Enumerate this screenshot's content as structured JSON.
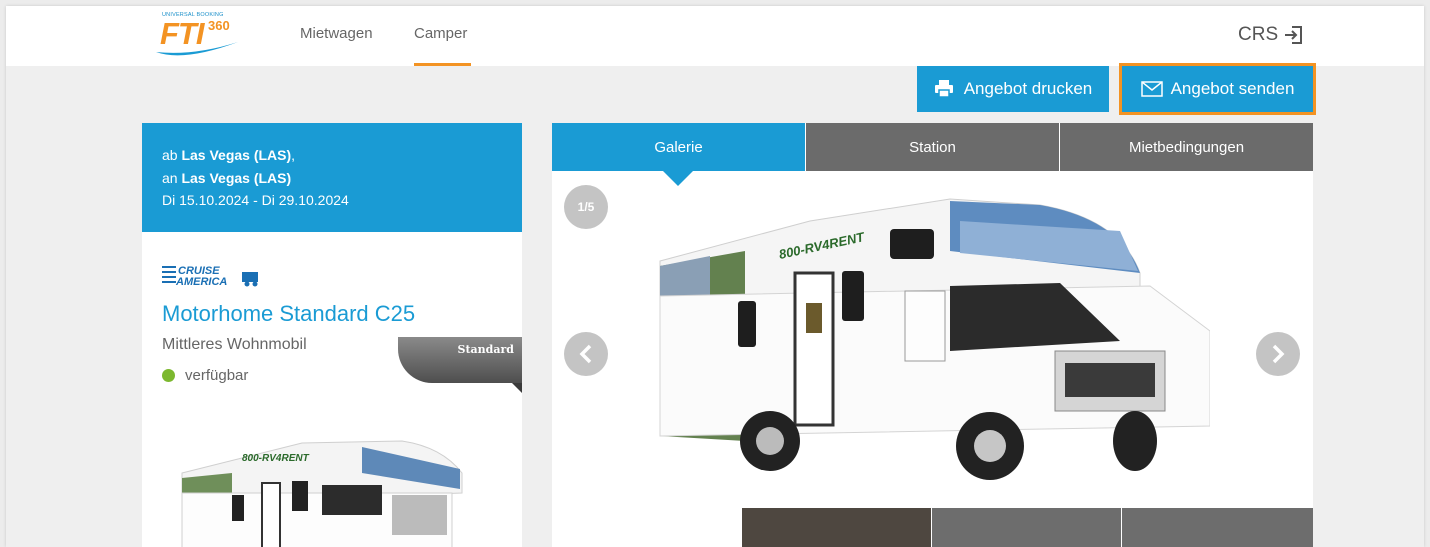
{
  "header": {
    "logo_small": "UNIVERSAL BOOKING",
    "logo_brand": "FTI",
    "logo_number": "360",
    "nav": [
      {
        "label": "Mietwagen"
      },
      {
        "label": "Camper"
      }
    ],
    "crs_label": "CRS",
    "accent_color": "#f39323"
  },
  "actions": {
    "print_label": "Angebot drucken",
    "send_label": "Angebot senden"
  },
  "route": {
    "from_prefix": "ab",
    "from_location": "Las Vegas (LAS)",
    "to_prefix": "an",
    "to_location": "Las Vegas (LAS)",
    "dates": "Di 15.10.2024 - Di 29.10.2024"
  },
  "vehicle": {
    "vendor_logo": "CRUISE AMERICA",
    "model": "Motorhome Standard C25",
    "category": "Mittleres Wohnmobil",
    "availability": "verfügbar",
    "badge": "Standard",
    "availability_color": "#7cb82f"
  },
  "gallery": {
    "tabs": [
      {
        "label": "Galerie"
      },
      {
        "label": "Station"
      },
      {
        "label": "Mietbedingungen"
      }
    ],
    "counter": "1/5",
    "rv_brand": "800-RV4RENT"
  },
  "colors": {
    "primary": "#1a9bd4",
    "tab_inactive": "#6b6b6b"
  }
}
